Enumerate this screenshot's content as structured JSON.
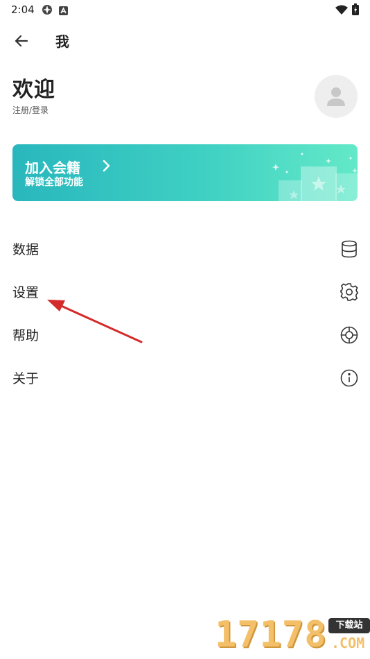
{
  "status_bar": {
    "time": "2:04",
    "icons": [
      "app-notification-icon",
      "a-notification-icon",
      "wifi-icon",
      "battery-icon"
    ]
  },
  "header": {
    "back_icon": "arrow-left-icon",
    "title": "我"
  },
  "profile": {
    "welcome": "欢迎",
    "login_link": "注册/登录",
    "avatar_icon": "user-avatar-icon"
  },
  "banner": {
    "title": "加入会籍",
    "subtitle": "解锁全部功能",
    "chevron_icon": "chevron-right-icon",
    "gradient": [
      "#29b7bd",
      "#63e9c8"
    ]
  },
  "menu": {
    "items": [
      {
        "label": "数据",
        "icon": "database-icon"
      },
      {
        "label": "设置",
        "icon": "gear-icon"
      },
      {
        "label": "帮助",
        "icon": "lifebuoy-icon"
      },
      {
        "label": "关于",
        "icon": "info-icon"
      }
    ]
  },
  "annotation": {
    "color": "#d42a2a"
  },
  "watermark": {
    "digits": "17178",
    "badge": "下载站",
    "suffix": ".COM"
  }
}
